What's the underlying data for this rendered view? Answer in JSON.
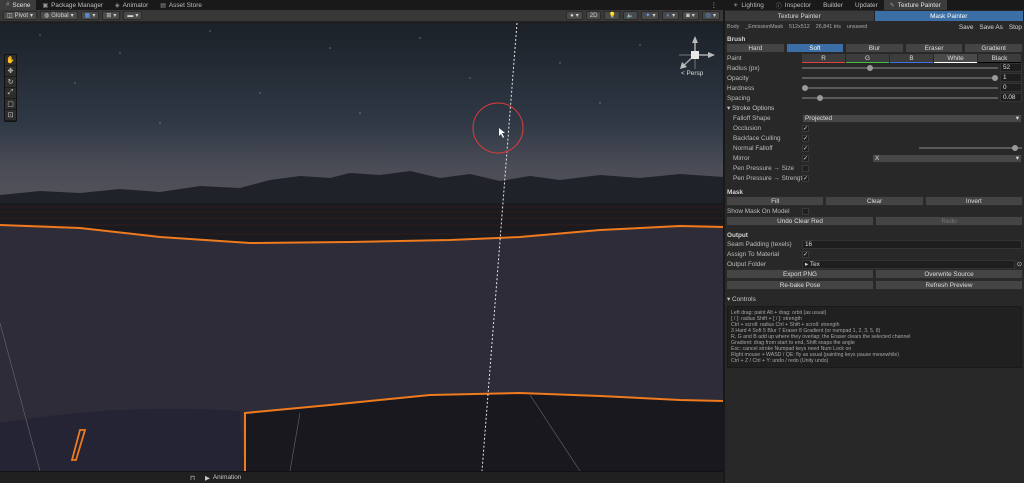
{
  "scene_tabs": [
    "Scene",
    "Package Manager",
    "Animator",
    "Asset Store"
  ],
  "toolbar": {
    "pivot": "Pivot",
    "global": "Global",
    "mode_2d": "2D"
  },
  "persp_label": "< Persp",
  "bottom_tab": "Animation",
  "right_tabs": [
    "Lighting",
    "Inspector",
    "Builder",
    "Updater",
    "Texture Painter"
  ],
  "subtabs": [
    "Texture Painter",
    "Mask Painter"
  ],
  "info": {
    "body": "Body",
    "mask": "_EmissionMask",
    "size": "512x512",
    "tris": "26,841 tris",
    "state": "unsaved",
    "save": "Save",
    "save_as": "Save As",
    "stop": "Stop"
  },
  "brush": {
    "title": "Brush",
    "modes": [
      "Hard",
      "Soft",
      "Blur",
      "Eraser",
      "Gradient"
    ],
    "selected": "Soft",
    "paint_label": "Paint",
    "channels": [
      "R",
      "G",
      "B",
      "White",
      "Black"
    ],
    "radius_label": "Radius (px)",
    "radius": "52",
    "radius_frac": 0.34,
    "opacity_label": "Opacity",
    "opacity": "1",
    "opacity_frac": 1.0,
    "hardness_label": "Hardness",
    "hardness": "0",
    "hardness_frac": 0.0,
    "spacing_label": "Spacing",
    "spacing": "0.08",
    "spacing_frac": 0.08
  },
  "stroke": {
    "title": "Stroke Options",
    "falloff_label": "Falloff Shape",
    "falloff": "Projected",
    "occlusion": "Occlusion",
    "backface": "Backface Culling",
    "normal": "Normal Falloff",
    "mirror": "Mirror",
    "mirror_axis": "X",
    "pen_size": "Pen Pressure → Size",
    "pen_strength": "Pen Pressure → Strength"
  },
  "mask": {
    "title": "Mask",
    "fill": "Fill",
    "clear": "Clear",
    "invert": "Invert",
    "show": "Show Mask On Model",
    "undo": "Undo Clear Red",
    "redo": "Redo"
  },
  "output": {
    "title": "Output",
    "seam_label": "Seam Padding (texels)",
    "seam": "16",
    "assign": "Assign To Material",
    "folder_label": "Output Folder",
    "folder": "Tex",
    "export": "Export PNG",
    "overwrite": "Overwrite Source",
    "rebake": "Re-bake Pose",
    "refresh": "Refresh Preview"
  },
  "controls": {
    "title": "Controls",
    "lines": [
      "Left drag: paint    Alt + drag: orbit (as usual)",
      "[ / ]: radius    Shift + [ / ]: strength",
      "Ctrl + scroll: radius    Ctrl + Shift + scroll: strength",
      "3 Hard   4 Soft   5 Blur   7 Eraser   8 Gradient    (or numpad 1, 2, 3, 5, 8)",
      "R, G and B add up where they overlap; the Eraser clears the selected channel",
      "Gradient: drag from start to end, Shift snaps the angle",
      "Esc: cancel stroke     Numpad keys need Num Lock on",
      "Right mouse + WASD / QE: fly as usual (painting keys pause meanwhile)",
      "Ctrl + Z / Ctrl + Y: undo / redo (Unity undo)"
    ]
  }
}
